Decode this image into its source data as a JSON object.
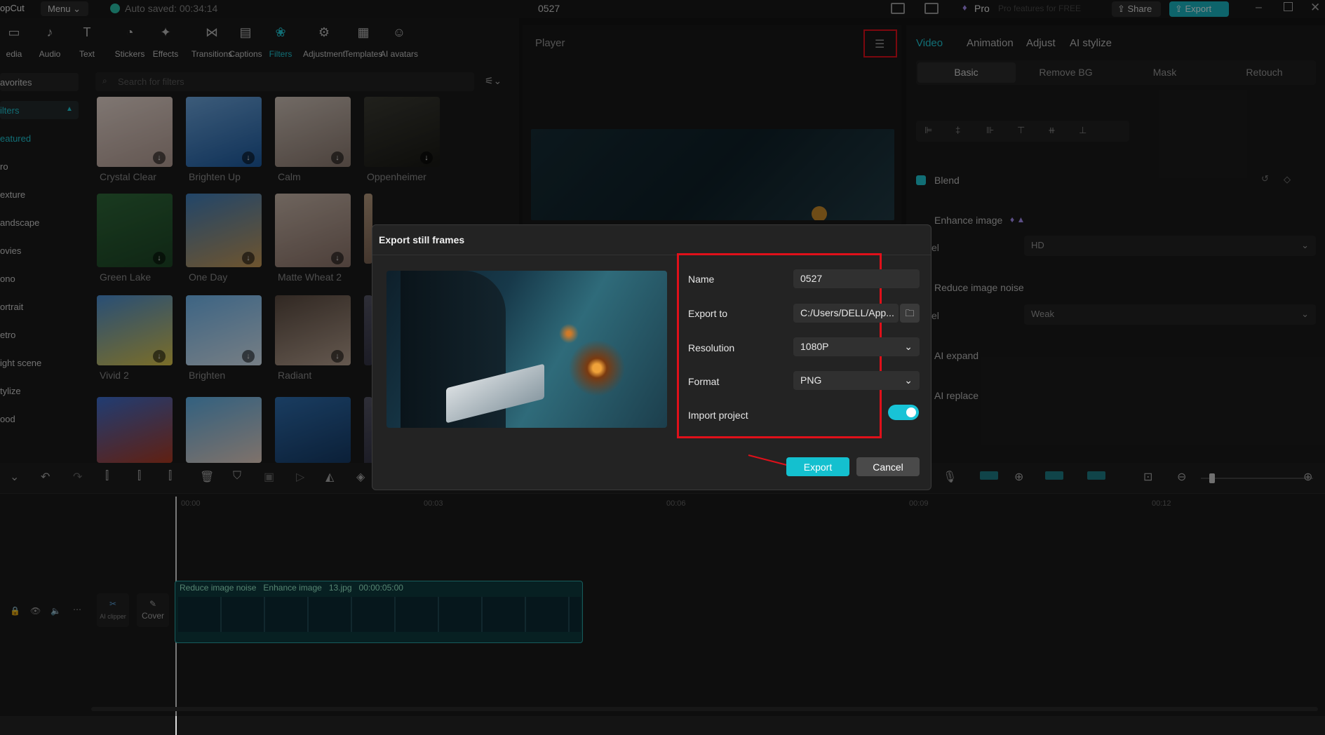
{
  "titlebar": {
    "app": "opCut",
    "menu": "Menu",
    "autosave": "Auto saved: 00:34:14",
    "project": "0527",
    "pro": "Pro",
    "pro_promo": "Pro features for FREE",
    "share": "Share",
    "export": "Export"
  },
  "toolbar": {
    "items": [
      "edia",
      "Audio",
      "Text",
      "Stickers",
      "Effects",
      "Transitions",
      "Captions",
      "Filters",
      "Adjustment",
      "Templates",
      "AI avatars"
    ],
    "active": "Filters",
    "icons": [
      "media-icon",
      "audio-icon",
      "text-icon",
      "stickers-icon",
      "effects-icon",
      "transitions-icon",
      "captions-icon",
      "filters-icon",
      "adjustment-icon",
      "templates-icon",
      "ai-avatars-icon"
    ]
  },
  "categories": [
    "avorites",
    "ilters",
    "eatured",
    "ro",
    "exture",
    "andscape",
    "ovies",
    "ono",
    "ortrait",
    "etro",
    "ight scene",
    "tylize",
    "ood"
  ],
  "search": {
    "placeholder": "Search for filters"
  },
  "filters": [
    "Crystal Clear",
    "Brighten Up",
    "Calm",
    "Oppenheimer",
    "Green Lake",
    "One Day",
    "Matte Wheat 2",
    "",
    "Vivid 2",
    "Brighten",
    "Radiant",
    "",
    "",
    "",
    "",
    ""
  ],
  "player": {
    "title": "Player"
  },
  "right_panel": {
    "tabs": [
      "Video",
      "Animation",
      "Adjust",
      "AI stylize"
    ],
    "active_tab": "Video",
    "subtabs": [
      "Basic",
      "Remove BG",
      "Mask",
      "Retouch"
    ],
    "blend": "Blend",
    "enhance": "Enhance image",
    "level1_label": "el",
    "level1_value": "HD",
    "noise": "Reduce image noise",
    "level2_label": "el",
    "level2_value": "Weak",
    "ai_expand": "AI expand",
    "ai_replace": "AI replace"
  },
  "timeline": {
    "ticks": [
      "00:00",
      "00:03",
      "00:06",
      "00:09",
      "00:12"
    ],
    "clip_tags": [
      "Reduce image noise",
      "Enhance image",
      "13.jpg",
      "00:00:05:00"
    ],
    "ai_clipper": "AI clipper",
    "cover": "Cover"
  },
  "modal": {
    "title": "Export still frames",
    "name_label": "Name",
    "name_value": "0527",
    "export_to_label": "Export to",
    "export_to_value": "C:/Users/DELL/App...",
    "resolution_label": "Resolution",
    "resolution_value": "1080P",
    "format_label": "Format",
    "format_value": "PNG",
    "import_label": "Import project",
    "import_on": true,
    "export_btn": "Export",
    "cancel_btn": "Cancel"
  },
  "colors": {
    "accent": "#20c9d6",
    "highlight": "#e0101a"
  }
}
